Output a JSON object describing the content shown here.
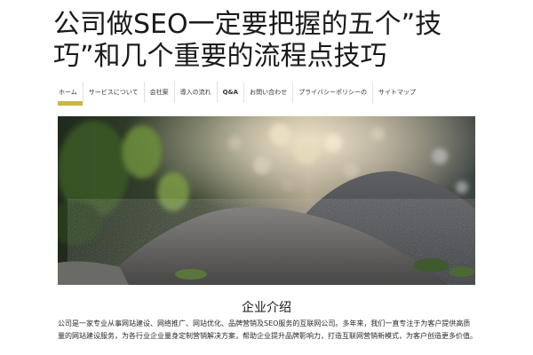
{
  "site": {
    "title": "公司做SEO一定要把握的五个”技巧”和几个重要的流程点技巧"
  },
  "nav": {
    "items": [
      {
        "label": "ホーム",
        "active": true,
        "bold": false
      },
      {
        "label": "サービスについて",
        "active": false,
        "bold": false
      },
      {
        "label": "会社案",
        "active": false,
        "bold": false
      },
      {
        "label": "導入の流れ",
        "active": false,
        "bold": false
      },
      {
        "label": "Q&A",
        "active": false,
        "bold": true
      },
      {
        "label": "お問い合わせ",
        "active": false,
        "bold": false
      },
      {
        "label": "プライバシーポリシーの",
        "active": false,
        "bold": false
      },
      {
        "label": "サイトマップ",
        "active": false,
        "bold": false
      }
    ]
  },
  "hero": {
    "image": "forest-rock-bokeh-photo",
    "colors": {
      "dark": "#2d3a2c",
      "rock": "#6f6c69",
      "light": "#e7ddc6",
      "moss": "#5c7a3a"
    }
  },
  "section": {
    "title": "企业介绍",
    "body": "公司是一家专业从事网站建设、网络推广、网站优化、品牌营销及SEO服务的互联网公司。多年来，我们一直专注于为客户提供高质量的网站建设服务，为各行业企业量身定制营销解决方案，帮助企业提升品牌影响力，打造互联网营销新模式，为客户创造更多价值。"
  },
  "theme": {
    "accent": "#cbb641",
    "text": "#1a1a1a"
  }
}
